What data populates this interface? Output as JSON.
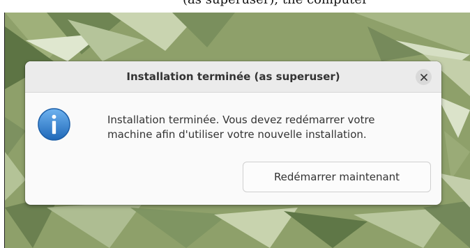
{
  "dialog": {
    "title": "Installation terminée (as superuser)",
    "message_line1": "Installation terminée. Vous devez redémarrer votre",
    "message_line2": "machine afin d'utiliser votre nouvelle installation.",
    "primary_button_label": "Redémarrer maintenant",
    "icon": "info-icon",
    "close_icon": "close-icon"
  },
  "background": {
    "partial_text": "(as superuser), the computer",
    "wallpaper_color": "#8ea06a"
  },
  "colors": {
    "titlebar": "#ebebeb",
    "dialog_body": "#fafafa",
    "info_icon_blue": "#2f7fd0",
    "text": "#333333"
  }
}
